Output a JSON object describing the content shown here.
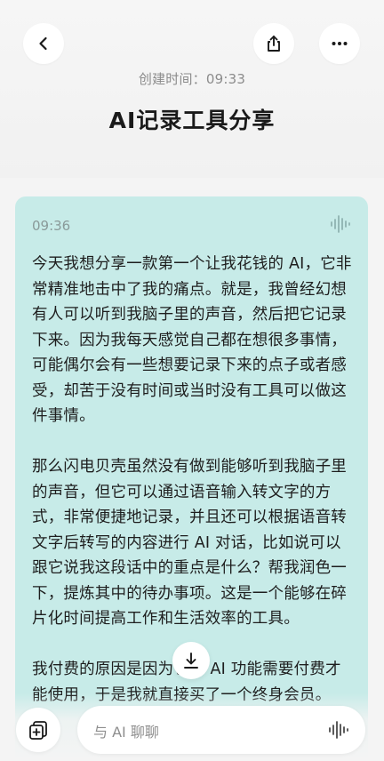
{
  "header": {
    "back_icon": "chevron-left-icon",
    "share_icon": "share-icon",
    "more_icon": "ellipsis-icon",
    "created_label": "创建时间：",
    "created_time": "09:33",
    "title": "AI记录工具分享"
  },
  "note": {
    "time": "09:36",
    "wave_icon": "waveform-icon",
    "paragraphs": [
      "今天我想分享一款第一个让我花钱的 AI，它非常精准地击中了我的痛点。就是，我曾经幻想有人可以听到我脑子里的声音，然后把它记录下来。因为我每天感觉自己都在想很多事情，可能偶尔会有一些想要记录下来的点子或者感受，却苦于没有时间或当时没有工具可以做这件事情。",
      "那么闪电贝壳虽然没有做到能够听到我脑子里的声音，但它可以通过语音输入转文字的方式，非常便捷地记录，并且还可以根据语音转文字后转写的内容进行 AI 对话，比如说可以跟它说我这段话中的重点是什么？帮我润色一下，提炼其中的待办事项。这是一个能够在碎片化时间提高工作和生活效率的工具。",
      "我付费的原因是因为它的 AI 功能需要付费才能使用，于是我就直接买了一个终身会员。"
    ]
  },
  "scroll_down_icon": "arrow-down-icon",
  "bottom": {
    "add_icon": "add-note-icon",
    "chat_placeholder": "与 AI 聊聊",
    "voice_icon": "waveform-icon"
  },
  "colors": {
    "card_bg": "#c7ebe8",
    "page_bg": "#f4f4f4"
  }
}
